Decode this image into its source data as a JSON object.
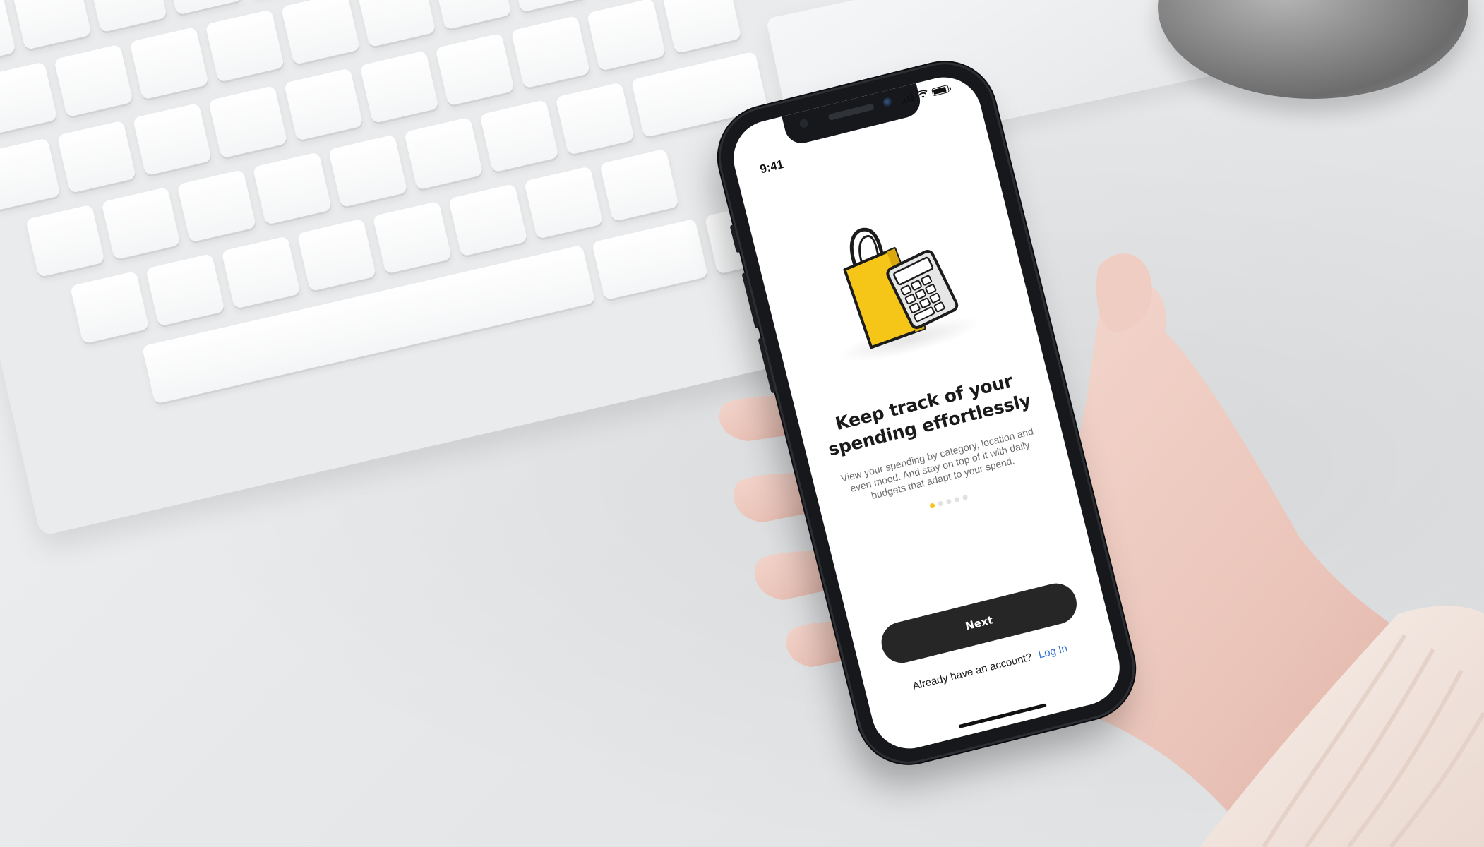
{
  "status_bar": {
    "time": "9:41"
  },
  "onboarding": {
    "illustration_icon": "shopping-bag-calculator-icon",
    "headline": "Keep track of your spending effortlessly",
    "description": "View your spending by category, location and even mood. And stay on top of it with daily budgets that adapt to your spend.",
    "page_indicator": {
      "total": 5,
      "current": 1
    },
    "next_label": "Next",
    "account_prompt": "Already have an account?",
    "login_label": "Log In"
  },
  "colors": {
    "accent_yellow": "#f5c518",
    "button_dark": "#262626",
    "link_blue": "#2f6fcf"
  }
}
